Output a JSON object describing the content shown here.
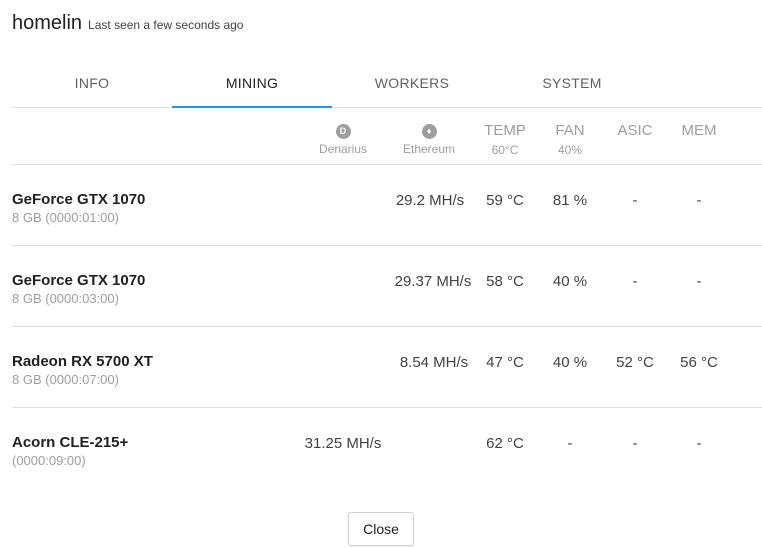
{
  "header": {
    "rig_name": "homelin",
    "last_seen": "Last seen a few seconds ago"
  },
  "tabs": [
    {
      "label": "INFO",
      "active": false
    },
    {
      "label": "MINING",
      "active": true
    },
    {
      "label": "WORKERS",
      "active": false
    },
    {
      "label": "SYSTEM",
      "active": false
    }
  ],
  "accent_color": "#2196f3",
  "columns": {
    "coin1": {
      "icon": "denarius-coin-icon",
      "glyph": "D",
      "label": "Denarius"
    },
    "coin2": {
      "icon": "ethereum-coin-icon",
      "glyph": "♦",
      "label": "Ethereum"
    },
    "temp": {
      "label": "TEMP",
      "sub": "60°C"
    },
    "fan": {
      "label": "FAN",
      "sub": "40%"
    },
    "asic": {
      "label": "ASIC"
    },
    "mem": {
      "label": "MEM"
    }
  },
  "devices": [
    {
      "name": "GeForce GTX 1070",
      "details": "8 GB (0000:01:00)",
      "denarius": "",
      "ethereum": "29.2 MH/s",
      "temp": "59 °C",
      "fan": "81 %",
      "asic": "-",
      "mem": "-"
    },
    {
      "name": "GeForce GTX 1070",
      "details": "8 GB (0000:03:00)",
      "denarius": "",
      "ethereum": "29.37 MH/s",
      "temp": "58 °C",
      "fan": "40 %",
      "asic": "-",
      "mem": "-"
    },
    {
      "name": "Radeon RX 5700 XT",
      "details": "8 GB (0000:07:00)",
      "denarius": "",
      "ethereum": "8.54 MH/s",
      "temp": "47 °C",
      "fan": "40 %",
      "asic": "52 °C",
      "mem": "56 °C"
    },
    {
      "name": "Acorn CLE-215+",
      "details": "(0000:09:00)",
      "denarius": "31.25 MH/s",
      "ethereum": "",
      "temp": "62 °C",
      "fan": "-",
      "asic": "-",
      "mem": "-"
    }
  ],
  "footer": {
    "close_label": "Close"
  }
}
